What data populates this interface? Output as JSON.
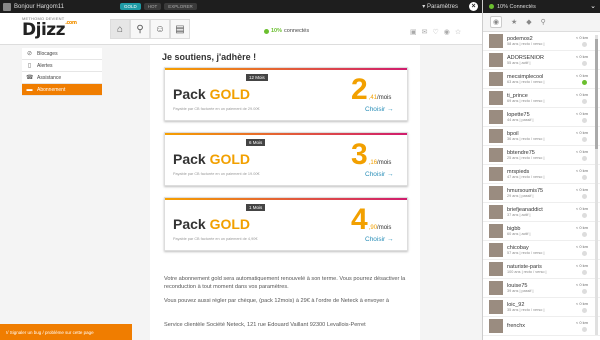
{
  "topbar": {
    "user": "Bonjour Hargom11",
    "pills": [
      "GOLD",
      "HOT",
      "EXPLORER"
    ],
    "params": "Paramètres"
  },
  "header": {
    "logo_top": "METHOMO DEVIENT",
    "logo": "Djizz",
    "logo_suffix": ".com",
    "online_pct": "10%",
    "online_label": "connectés"
  },
  "sidemenu": [
    {
      "label": "Blocages",
      "icon": "block-icon"
    },
    {
      "label": "Alertes",
      "icon": "document-icon"
    },
    {
      "label": "Assistance",
      "icon": "phone-icon"
    },
    {
      "label": "Abonnement",
      "icon": "card-icon"
    }
  ],
  "content": {
    "title": "Je soutiens, j'adhère !",
    "packs": [
      {
        "name_a": "Pack ",
        "name_b": "GOLD",
        "duration": "12 Mois",
        "big": "2",
        "dec": ",41",
        "per": "/mois",
        "payment": "Payable par CB facturée en un paiement de 29.00€",
        "choose": "Choisir"
      },
      {
        "name_a": "Pack ",
        "name_b": "GOLD",
        "duration": "6 Mois",
        "big": "3",
        "dec": ",16",
        "per": "/mois",
        "payment": "Payable par CB facturée en un paiement de 19.00€",
        "choose": "Choisir"
      },
      {
        "name_a": "Pack ",
        "name_b": "GOLD",
        "duration": "1 Mois",
        "big": "4",
        "dec": ",90",
        "per": "/mois",
        "payment": "Payable par CB facturée en un paiement de 4,90€",
        "choose": "Choisir"
      }
    ],
    "para1": "Votre abonnement gold sera automatiquement renouvelé à son terme. Vous pourrez désactiver la reconduction à tout moment dans vos paramètres.",
    "para2": "Vous pouvez aussi régler par chèque, (pack 12mois) à 29€ à l'ordre de Neteck à envoyer à",
    "para3": "Service clientèle Société Neteck, 121 rue Edouard Vaillant 92300 Levallois-Perret"
  },
  "bottombar": "Signaler un bug / problème sur cette page",
  "panel": {
    "title": "10% Connectés",
    "members": [
      {
        "name": "podemos2",
        "info": "58 ans | recto / verso |",
        "km": "< 0 km",
        "online": false
      },
      {
        "name": "ADORSENIOR",
        "info": "55 ans | actif |",
        "km": "< 0 km",
        "online": false
      },
      {
        "name": "mecsimplecool",
        "info": "63 ans | recto / verso |",
        "km": "< 0 km",
        "online": true
      },
      {
        "name": "ti_prince",
        "info": "69 ans | recto / verso |",
        "km": "< 0 km",
        "online": false
      },
      {
        "name": "lopette75",
        "info": "44 ans | passif |",
        "km": "< 0 km",
        "online": false
      },
      {
        "name": "bpoil",
        "info": "36 ans | recto / verso |",
        "km": "< 0 km",
        "online": false
      },
      {
        "name": "bbtendre75",
        "info": "25 ans | recto / verso |",
        "km": "< 0 km",
        "online": false
      },
      {
        "name": "mrspieds",
        "info": "47 ans | recto / verso |",
        "km": "< 0 km",
        "online": false
      },
      {
        "name": "hmursoumis75",
        "info": "29 ans | passif |",
        "km": "< 0 km",
        "online": false
      },
      {
        "name": "briefjeanaddict",
        "info": "37 ans | actif |",
        "km": "< 0 km",
        "online": false
      },
      {
        "name": "bigbb",
        "info": "60 ans | actif |",
        "km": "< 0 km",
        "online": false
      },
      {
        "name": "chicobay",
        "info": "57 ans | recto / verso |",
        "km": "< 0 km",
        "online": false
      },
      {
        "name": "naturiste-paris",
        "info": "100 ans | recto / verso |",
        "km": "< 0 km",
        "online": false
      },
      {
        "name": "louise75",
        "info": "39 ans | passif |",
        "km": "< 0 km",
        "online": false
      },
      {
        "name": "loic_92",
        "info": "35 ans | recto / verso |",
        "km": "< 0 km",
        "online": false
      },
      {
        "name": "frenchx",
        "info": "",
        "km": "< 0 km",
        "online": false
      }
    ]
  }
}
